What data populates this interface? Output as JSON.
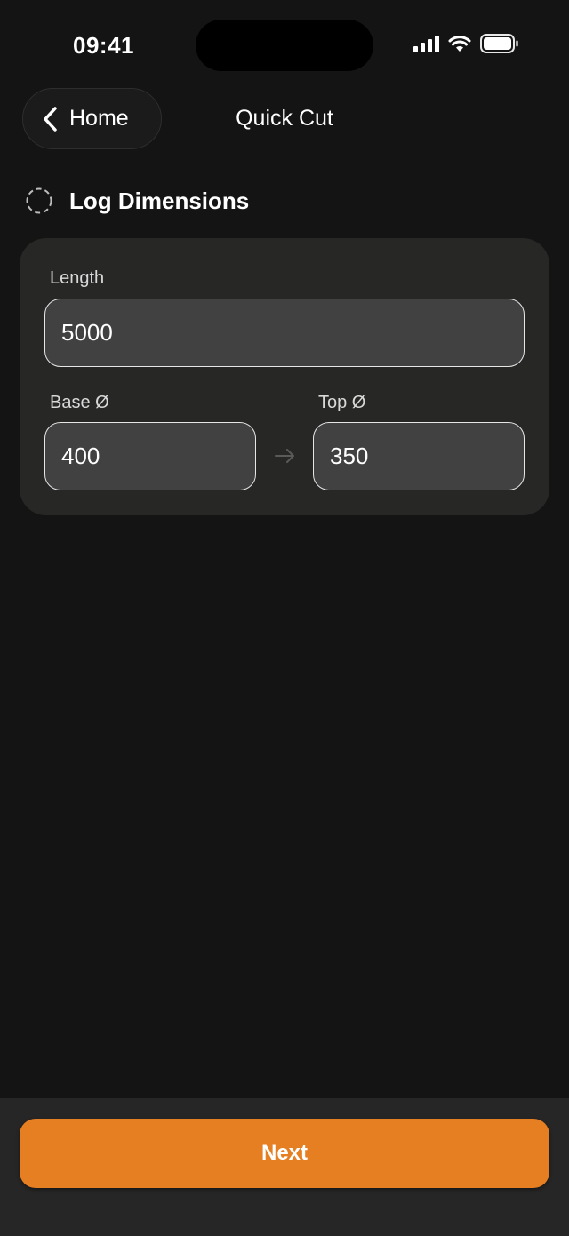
{
  "status_bar": {
    "time": "09:41"
  },
  "nav": {
    "back_label": "Home",
    "title": "Quick Cut"
  },
  "section": {
    "title": "Log Dimensions",
    "icon": "dashed-circle-icon"
  },
  "form": {
    "length": {
      "label": "Length",
      "value": "5000"
    },
    "base_diameter": {
      "label": "Base Ø",
      "value": "400"
    },
    "top_diameter": {
      "label": "Top Ø",
      "value": "350"
    }
  },
  "footer": {
    "next_label": "Next"
  },
  "colors": {
    "background": "#141414",
    "card": "#272726",
    "accent": "#e67e22",
    "input": "#414141"
  }
}
